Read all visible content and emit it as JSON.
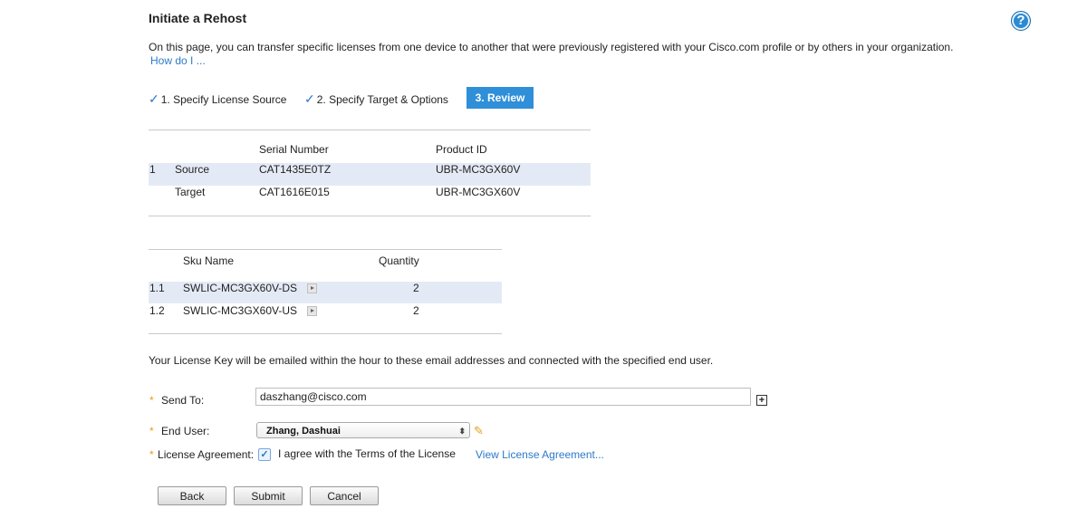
{
  "page": {
    "title": "Initiate a Rehost",
    "help_icon": "help-circle-icon",
    "intro": "On this page, you can transfer specific licenses from one device to another that were previously registered with your Cisco.com profile or by others in your organization.",
    "how_do_i": "How do I ..."
  },
  "steps": [
    {
      "label": "1. Specify License Source",
      "done": true
    },
    {
      "label": "2. Specify Target & Options",
      "done": true
    },
    {
      "label": "3. Review",
      "active": true
    }
  ],
  "device_table": {
    "headers": {
      "serial": "Serial Number",
      "product": "Product ID"
    },
    "rows": [
      {
        "num": "1",
        "role": "Source",
        "serial": "CAT1435E0TZ",
        "product": "UBR-MC3GX60V"
      },
      {
        "num": "",
        "role": "Target",
        "serial": "CAT1616E015",
        "product": "UBR-MC3GX60V"
      }
    ]
  },
  "sku_table": {
    "headers": {
      "sku": "Sku Name",
      "qty": "Quantity"
    },
    "rows": [
      {
        "num": "1.1",
        "sku": "SWLIC-MC3GX60V-DS",
        "qty": "2"
      },
      {
        "num": "1.2",
        "sku": "SWLIC-MC3GX60V-US",
        "qty": "2"
      }
    ]
  },
  "form": {
    "notice": "Your License Key will be emailed within the hour to these email addresses and connected with the specified end user.",
    "required_mark": "*",
    "send_to_label": "Send To:",
    "send_to_value": "daszhang@cisco.com",
    "add_icon": "plus-box-icon",
    "end_user_label": "End User:",
    "end_user_value": "Zhang, Dashuai",
    "edit_icon": "pencil-icon",
    "agreement_label": "License Agreement:",
    "agreement_checked": true,
    "agreement_text": "I agree with the Terms of the License",
    "view_agreement": "View License Agreement..."
  },
  "buttons": {
    "back": "Back",
    "submit": "Submit",
    "cancel": "Cancel"
  },
  "colors": {
    "link": "#2b7ac9",
    "active_step": "#2f8fd8",
    "row_highlight": "#e4eaf5",
    "required": "#e69a1c"
  }
}
